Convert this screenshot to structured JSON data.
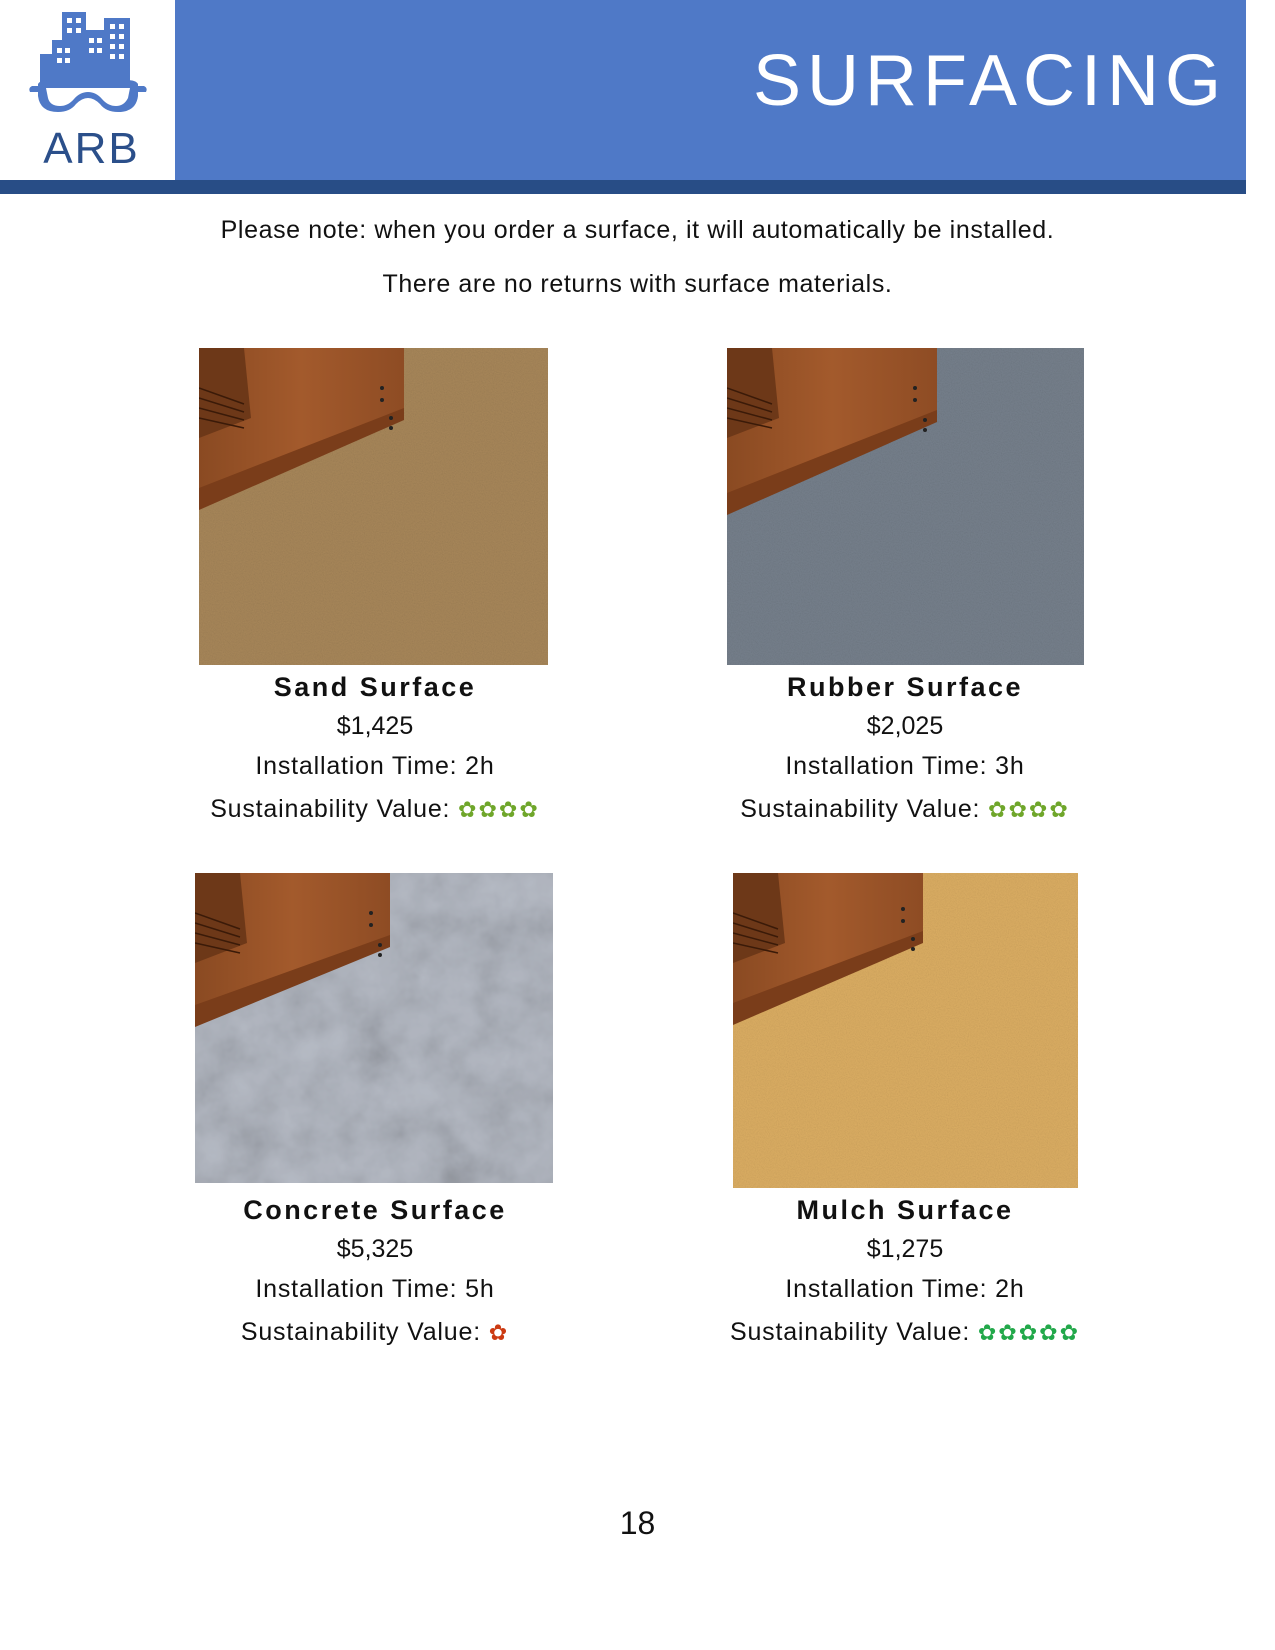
{
  "header": {
    "logo_text": "ARB",
    "title": "SURFACING",
    "colors": {
      "bar": "#4f79c7",
      "underline": "#284d86",
      "logo": "#2b4f8a"
    }
  },
  "notes": [
    "Please note: when you order a surface, it will automatically be installed.",
    "There are no returns with surface materials."
  ],
  "products": [
    {
      "name": "Sand Surface",
      "price": "$1,425",
      "installation": "Installation Time: 2h",
      "sustainability_label": "Sustainability Value:",
      "sustainability_flowers": "✿✿✿✿",
      "sustainability_rating": 4,
      "flower_color": "#6fa62a",
      "texture": "sand"
    },
    {
      "name": "Rubber Surface",
      "price": "$2,025",
      "installation": "Installation Time: 3h",
      "sustainability_label": "Sustainability Value:",
      "sustainability_flowers": "✿✿✿✿",
      "sustainability_rating": 4,
      "flower_color": "#6fa62a",
      "texture": "rubber"
    },
    {
      "name": "Concrete Surface",
      "price": "$5,325",
      "installation": "Installation Time: 5h",
      "sustainability_label": "Sustainability Value:",
      "sustainability_flowers": "✿",
      "sustainability_rating": 1,
      "flower_color": "#cc3a12",
      "texture": "concrete"
    },
    {
      "name": "Mulch Surface",
      "price": "$1,275",
      "installation": "Installation Time: 2h",
      "sustainability_label": "Sustainability Value:",
      "sustainability_flowers": "✿✿✿✿✿",
      "sustainability_rating": 5,
      "flower_color": "#22a84a",
      "texture": "mulch"
    }
  ],
  "page_number": "18"
}
